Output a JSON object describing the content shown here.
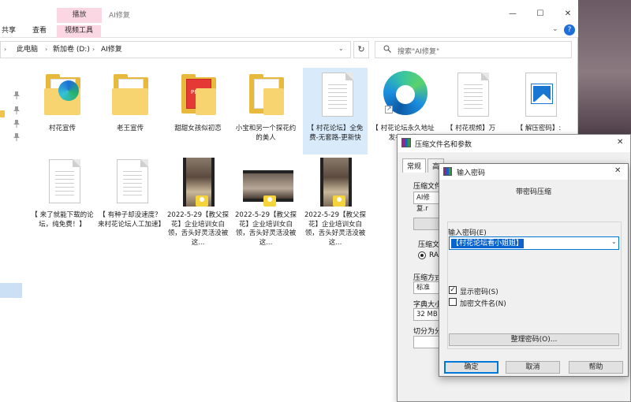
{
  "explorer": {
    "title": "AI修复",
    "ribbon": {
      "context_tab": "播放",
      "tabs": [
        "共享",
        "查看",
        "视频工具"
      ]
    },
    "address": {
      "crumbs": [
        "此电脑",
        "新加卷 (D:)",
        "AI修复"
      ]
    },
    "search_placeholder": "搜索\"AI修复\"",
    "items": [
      {
        "type": "folder-edge",
        "label": "村花宣传"
      },
      {
        "type": "folder",
        "label": "老王宣传"
      },
      {
        "type": "folder-pdf",
        "label": "甜甜女孩似初恋"
      },
      {
        "type": "folder",
        "label": "小宝和另一个探花约的美人"
      },
      {
        "type": "doc",
        "label": "【 村花论坛】全免费-无套路-更新快",
        "selected": true
      },
      {
        "type": "edge",
        "label": "【 村花论坛永久地址发布页 此"
      },
      {
        "type": "doc",
        "label": "【 村花视频】万"
      },
      {
        "type": "image",
        "label": "【 解压密码】:"
      },
      {
        "type": "doc",
        "label": "【 来了就能下载的论坛，纯免费！】"
      },
      {
        "type": "doc",
        "label": "【 有种子却没速度？来村花论坛人工加速】"
      },
      {
        "type": "video",
        "label": "2022-5-29【教父探花】企业培训女白领，舌头好灵活没被这..."
      },
      {
        "type": "video-wide",
        "label": "2022-5-29【教父探花】企业培训女白领，舌头好灵活没被这..."
      },
      {
        "type": "video",
        "label": "2022-5-29【教父探花】企业培训女白领，舌头好灵活没被这..."
      }
    ]
  },
  "archive_dialog": {
    "title": "压缩文件名和参数",
    "tabs": [
      "常规",
      "高"
    ],
    "labels": {
      "archive_name": "压缩文件",
      "archive_name_value": "AI修复.r",
      "format": "压缩文",
      "format_value": "RAR",
      "method": "压缩方式",
      "method_value": "标准",
      "dict": "字典大小",
      "dict_value": "32 MB",
      "split": "切分为分"
    }
  },
  "password_dialog": {
    "title": "输入密码",
    "header": "带密码压缩",
    "input_label": "输入密码(E)",
    "password_value": "【村花论坛看小姐姐】",
    "show_password": "显示密码(S)",
    "encrypt_names": "加密文件名(N)",
    "organize": "整理密码(O)...",
    "ok": "确定",
    "cancel": "取消",
    "help": "帮助"
  }
}
